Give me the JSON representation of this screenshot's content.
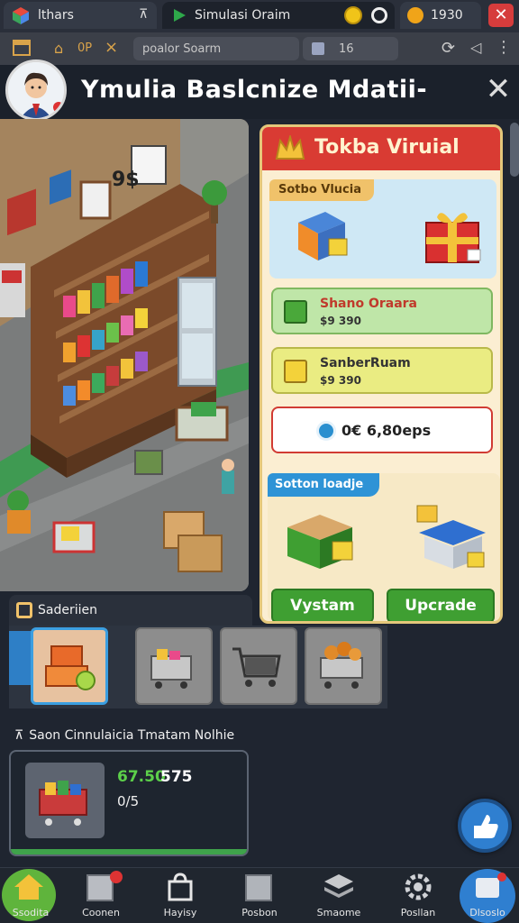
{
  "browser": {
    "tabs": [
      {
        "label": "lthars"
      },
      {
        "label": "Simulasi Oraim"
      },
      {
        "label": "1930"
      }
    ],
    "nav_buttons": {
      "home": "0P"
    },
    "address": {
      "value": "poalor Soarm",
      "tab_count": "16"
    }
  },
  "header": {
    "title": "Ymulia Baslcnize Mdatii-"
  },
  "shop": {
    "title": "Tokba Viruial",
    "section1_label": "Sotbo Vlucia",
    "items": [
      {
        "name": "Shano Oraara",
        "price": "$9 390"
      },
      {
        "name": "SanberRuam",
        "price": "$9 390"
      }
    ],
    "balance": "0€ 6,80eps",
    "section2_label": "Sotton loadje",
    "btn_left": "Vystam",
    "btn_right": "Upcrade"
  },
  "categories": {
    "label": "Saderiien"
  },
  "stats": {
    "label": "Saon Cinnulaicia Tmatam Nolhie",
    "value_main": "67.50",
    "value_side": "575",
    "value_sub": "0/5"
  },
  "scene": {
    "price_sign": "9$"
  },
  "nav": {
    "items": [
      {
        "label": "Ssodita"
      },
      {
        "label": "Coonen"
      },
      {
        "label": "Hayisy"
      },
      {
        "label": "Posbon"
      },
      {
        "label": "Smaome"
      },
      {
        "label": "Posllan"
      },
      {
        "label": "Dlsoslo"
      }
    ]
  },
  "colors": {
    "shop_header": "#d93b33",
    "green_button": "#3f9f32",
    "fab": "#2f7fd0"
  }
}
